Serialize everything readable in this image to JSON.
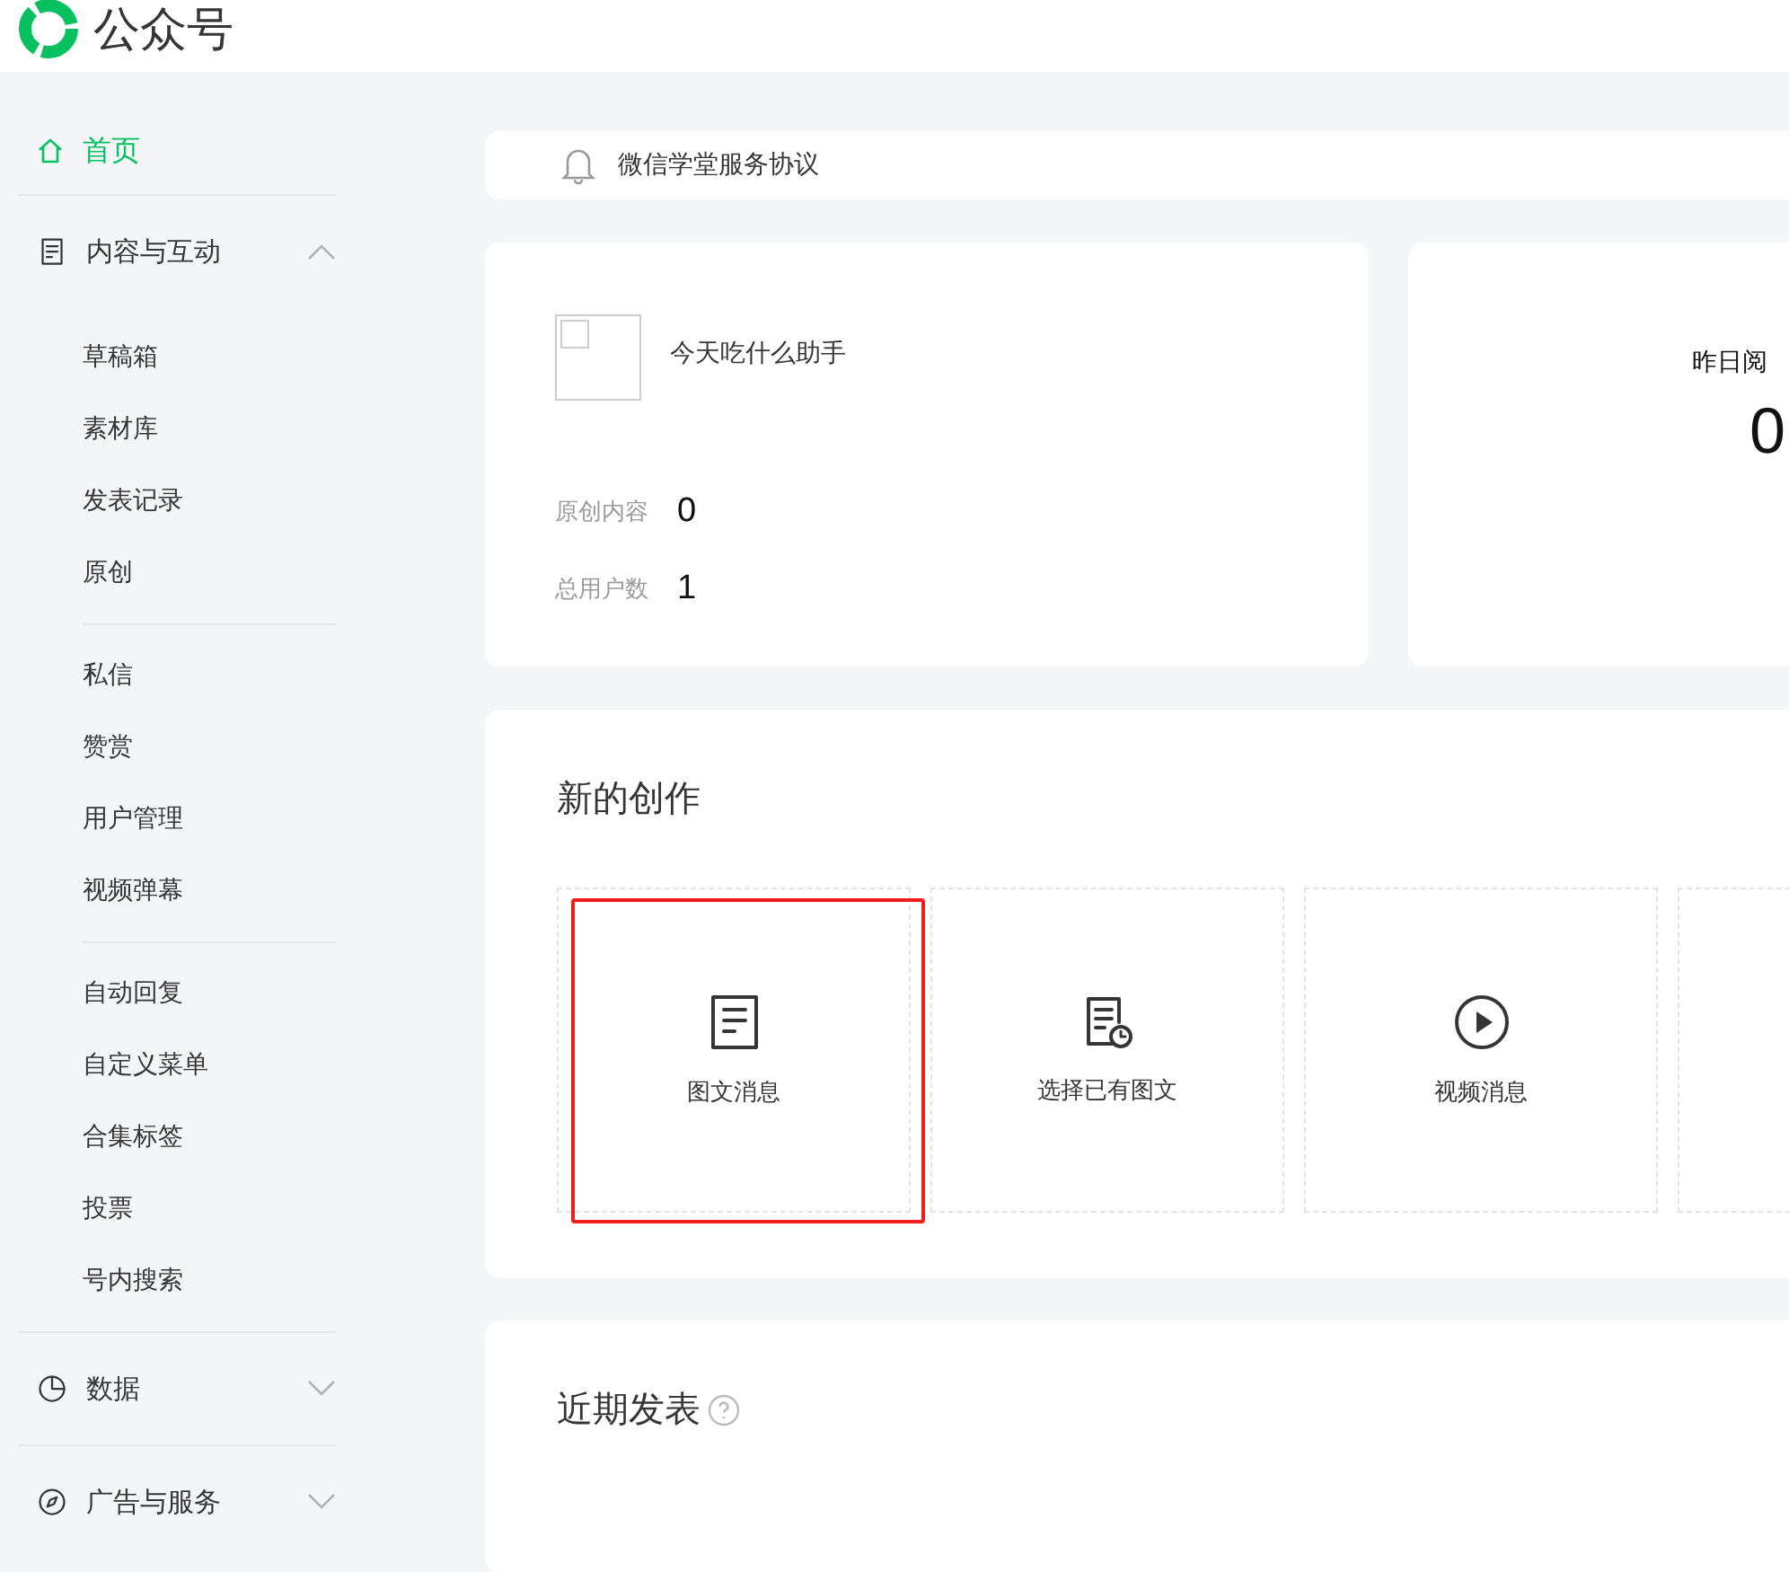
{
  "header": {
    "title": "公众号"
  },
  "sidebar": {
    "home": {
      "label": "首页",
      "selected": true
    },
    "groups": [
      {
        "label": "内容与互动",
        "expanded": true,
        "sections": [
          [
            "草稿箱",
            "素材库",
            "发表记录",
            "原创"
          ],
          [
            "私信",
            "赞赏",
            "用户管理",
            "视频弹幕"
          ],
          [
            "自动回复",
            "自定义菜单",
            "合集标签",
            "投票",
            "号内搜索"
          ]
        ]
      },
      {
        "label": "数据",
        "expanded": false
      },
      {
        "label": "广告与服务",
        "expanded": false
      }
    ]
  },
  "notice": {
    "text": "微信学堂服务协议"
  },
  "account": {
    "name": "今天吃什么助手",
    "stats": [
      {
        "label": "原创内容",
        "value": "0"
      },
      {
        "label": "总用户数",
        "value": "1"
      }
    ]
  },
  "yesterday": {
    "label": "昨日阅",
    "value": "0"
  },
  "creation": {
    "title": "新的创作",
    "options": [
      {
        "label": "图文消息",
        "kind": "article",
        "highlighted": true
      },
      {
        "label": "选择已有图文",
        "kind": "existing",
        "highlighted": false
      },
      {
        "label": "视频消息",
        "kind": "video",
        "highlighted": false
      }
    ]
  },
  "recent": {
    "title": "近期发表"
  }
}
